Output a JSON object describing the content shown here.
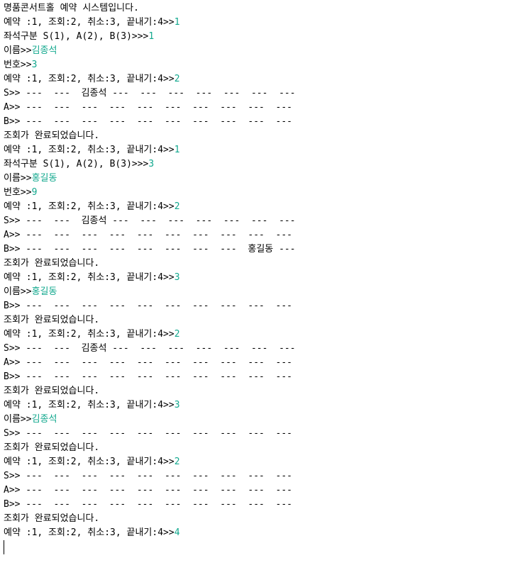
{
  "console": {
    "input_color": "#12a88e",
    "lines": [
      {
        "prompt": "명품콘서트홀 예약 시스템입니다.",
        "input": ""
      },
      {
        "prompt": "예약 :1, 조회:2, 취소:3, 끝내기:4>>",
        "input": "1"
      },
      {
        "prompt": "좌석구분 S(1), A(2), B(3)>>>",
        "input": "1"
      },
      {
        "prompt": "이름>>",
        "input": "김종석"
      },
      {
        "prompt": "번호>>",
        "input": "3"
      },
      {
        "prompt": "예약 :1, 조회:2, 취소:3, 끝내기:4>>",
        "input": "2"
      },
      {
        "prompt": "S>> ---  ---  김종석 ---  ---  ---  ---  ---  ---  ---",
        "input": ""
      },
      {
        "prompt": "A>> ---  ---  ---  ---  ---  ---  ---  ---  ---  ---",
        "input": ""
      },
      {
        "prompt": "B>> ---  ---  ---  ---  ---  ---  ---  ---  ---  ---",
        "input": ""
      },
      {
        "prompt": "조회가 완료되었습니다.",
        "input": ""
      },
      {
        "prompt": "예약 :1, 조회:2, 취소:3, 끝내기:4>>",
        "input": "1"
      },
      {
        "prompt": "좌석구분 S(1), A(2), B(3)>>>",
        "input": "3"
      },
      {
        "prompt": "이름>>",
        "input": "홍길동"
      },
      {
        "prompt": "번호>>",
        "input": "9"
      },
      {
        "prompt": "예약 :1, 조회:2, 취소:3, 끝내기:4>>",
        "input": "2"
      },
      {
        "prompt": "S>> ---  ---  김종석 ---  ---  ---  ---  ---  ---  ---",
        "input": ""
      },
      {
        "prompt": "A>> ---  ---  ---  ---  ---  ---  ---  ---  ---  ---",
        "input": ""
      },
      {
        "prompt": "B>> ---  ---  ---  ---  ---  ---  ---  ---  홍길동 ---",
        "input": ""
      },
      {
        "prompt": "조회가 완료되었습니다.",
        "input": ""
      },
      {
        "prompt": "예약 :1, 조회:2, 취소:3, 끝내기:4>>",
        "input": "3"
      },
      {
        "prompt": "이름>>",
        "input": "홍길동"
      },
      {
        "prompt": "B>> ---  ---  ---  ---  ---  ---  ---  ---  ---  ---",
        "input": ""
      },
      {
        "prompt": "조회가 완료되었습니다.",
        "input": ""
      },
      {
        "prompt": "예약 :1, 조회:2, 취소:3, 끝내기:4>>",
        "input": "2"
      },
      {
        "prompt": "S>> ---  ---  김종석 ---  ---  ---  ---  ---  ---  ---",
        "input": ""
      },
      {
        "prompt": "A>> ---  ---  ---  ---  ---  ---  ---  ---  ---  ---",
        "input": ""
      },
      {
        "prompt": "B>> ---  ---  ---  ---  ---  ---  ---  ---  ---  ---",
        "input": ""
      },
      {
        "prompt": "조회가 완료되었습니다.",
        "input": ""
      },
      {
        "prompt": "예약 :1, 조회:2, 취소:3, 끝내기:4>>",
        "input": "3"
      },
      {
        "prompt": "이름>>",
        "input": "김종석"
      },
      {
        "prompt": "S>> ---  ---  ---  ---  ---  ---  ---  ---  ---  ---",
        "input": ""
      },
      {
        "prompt": "조회가 완료되었습니다.",
        "input": ""
      },
      {
        "prompt": "예약 :1, 조회:2, 취소:3, 끝내기:4>>",
        "input": "2"
      },
      {
        "prompt": "S>> ---  ---  ---  ---  ---  ---  ---  ---  ---  ---",
        "input": ""
      },
      {
        "prompt": "A>> ---  ---  ---  ---  ---  ---  ---  ---  ---  ---",
        "input": ""
      },
      {
        "prompt": "B>> ---  ---  ---  ---  ---  ---  ---  ---  ---  ---",
        "input": ""
      },
      {
        "prompt": "조회가 완료되었습니다.",
        "input": ""
      },
      {
        "prompt": "예약 :1, 조회:2, 취소:3, 끝내기:4>>",
        "input": "4"
      }
    ]
  }
}
